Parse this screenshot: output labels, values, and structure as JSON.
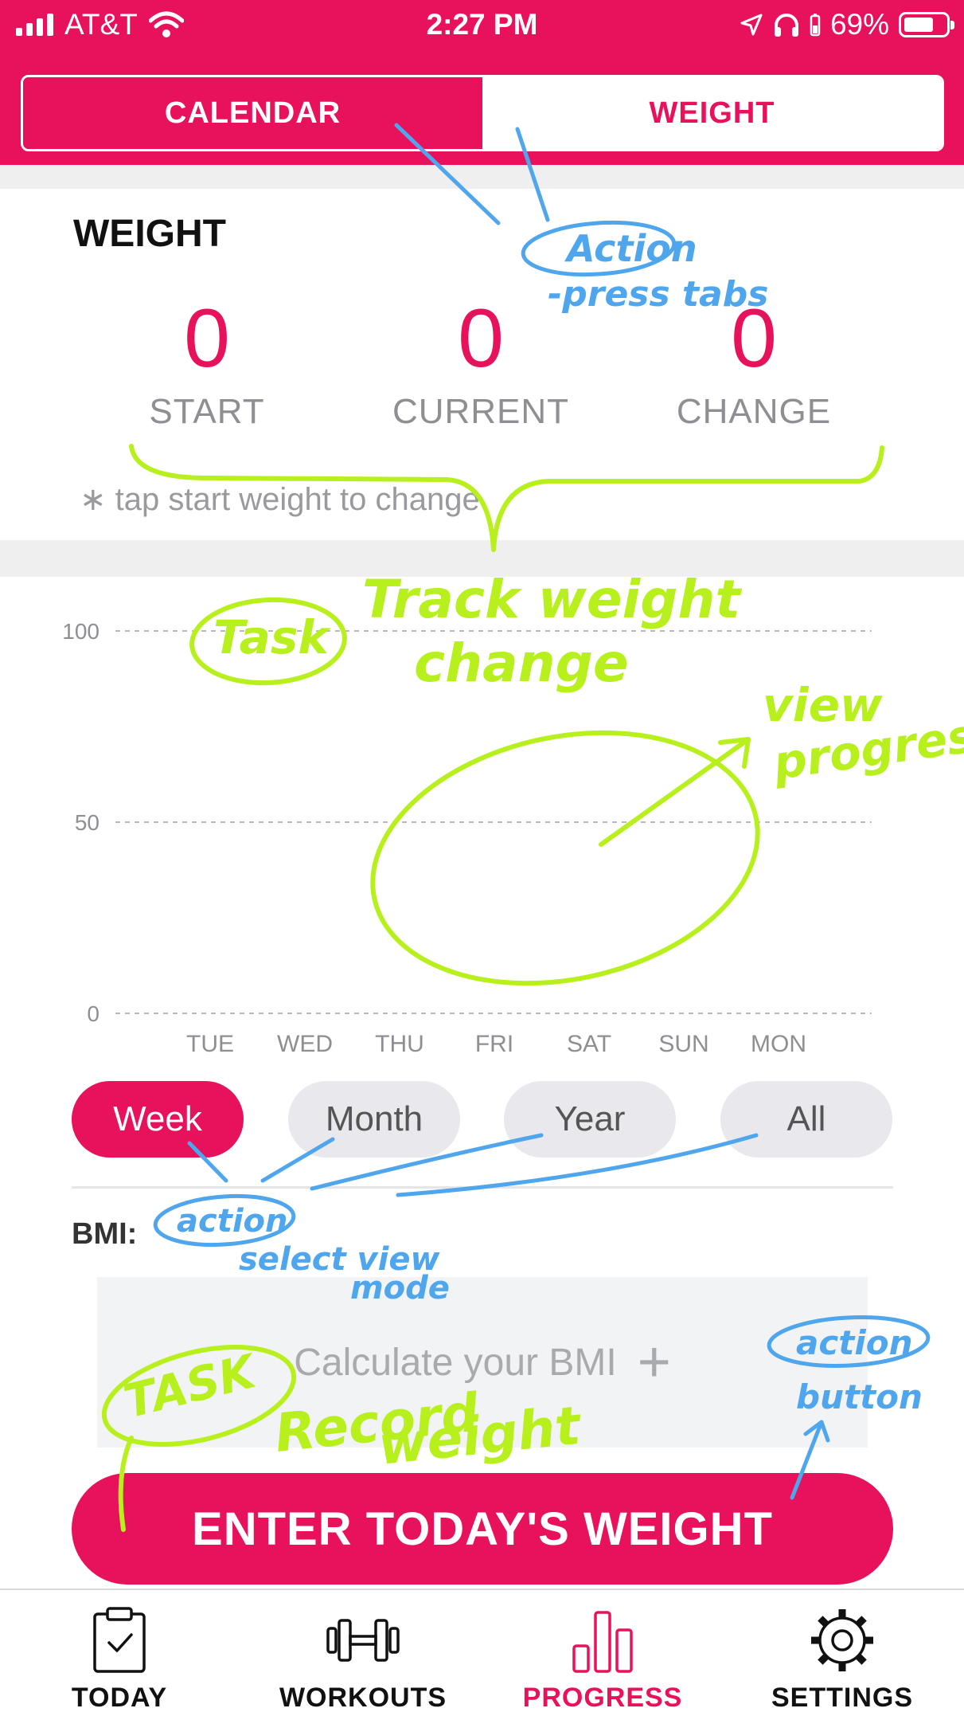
{
  "status_bar": {
    "carrier": "AT&T",
    "time": "2:27 PM",
    "battery": "69%"
  },
  "segmented": {
    "calendar_label": "CALENDAR",
    "weight_label": "WEIGHT"
  },
  "weight_summary": {
    "title": "WEIGHT",
    "stats": [
      {
        "value": "0",
        "label": "START"
      },
      {
        "value": "0",
        "label": "CURRENT"
      },
      {
        "value": "0",
        "label": "CHANGE"
      }
    ],
    "hint": "∗ tap start weight to change"
  },
  "chart_data": {
    "type": "line",
    "categories": [
      "TUE",
      "WED",
      "THU",
      "FRI",
      "SAT",
      "SUN",
      "MON"
    ],
    "y_ticks": [
      "100",
      "50",
      "0"
    ],
    "ylim": [
      0,
      100
    ],
    "grid": true,
    "series": []
  },
  "range": {
    "options": [
      "Week",
      "Month",
      "Year",
      "All"
    ],
    "selected": "Week"
  },
  "bmi": {
    "label": "BMI:",
    "calculate_label": "Calculate your BMI",
    "plus": "+"
  },
  "enter_button": "ENTER TODAY'S WEIGHT",
  "tab_bar": {
    "items": [
      {
        "label": "TODAY",
        "icon": "clipboard-check-icon"
      },
      {
        "label": "WORKOUTS",
        "icon": "dumbbell-icon"
      },
      {
        "label": "PROGRESS",
        "icon": "bar-chart-icon"
      },
      {
        "label": "SETTINGS",
        "icon": "gear-icon"
      }
    ],
    "active": "PROGRESS"
  },
  "annotations": {
    "action_tabs_1": "Action",
    "action_tabs_2": "-press tabs",
    "task_1": "Task",
    "task_1_text_1": "Track weight",
    "task_1_text_2": "change",
    "view_progress_1": "view",
    "view_progress_2": "progress",
    "action_select": "action",
    "select_text_1": "select view",
    "select_text_2": "mode",
    "task_2": "TASK",
    "record_1": "Record",
    "record_2": "weight",
    "action_button_1": "action",
    "action_button_2": "button"
  },
  "colors": {
    "accent": "#e8115b",
    "annotation_green": "#b7f01c",
    "annotation_blue": "#4fa6ec"
  }
}
